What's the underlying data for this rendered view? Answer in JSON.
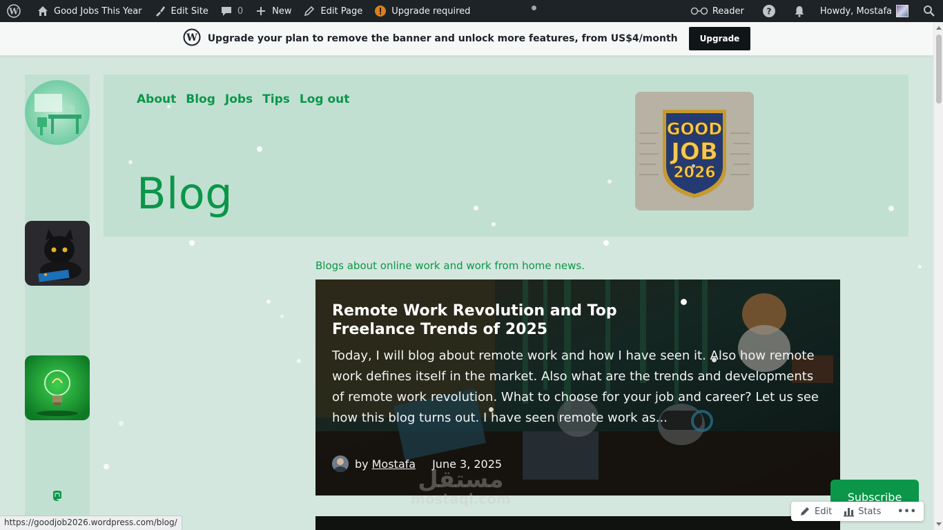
{
  "admin_bar": {
    "site_name": "Good Jobs This Year",
    "edit_site": "Edit Site",
    "comments_count": "0",
    "new_label": "New",
    "edit_page": "Edit Page",
    "upgrade_required": "Upgrade required",
    "reader": "Reader",
    "greeting": "Howdy, Mostafa",
    "icons": [
      "wordpress-logo",
      "home",
      "brush",
      "comment",
      "plus",
      "pencil",
      "alert",
      "reader-glasses",
      "help",
      "bell",
      "search"
    ]
  },
  "banner": {
    "message": "Upgrade your plan to remove the banner and unlock more features, from US$4/month",
    "button": "Upgrade"
  },
  "nav": {
    "items": [
      "About",
      "Blog",
      "Jobs",
      "Tips",
      "Log out"
    ]
  },
  "page": {
    "title": "Blog",
    "tagline": "Blogs about online work and work from home news."
  },
  "logo": {
    "line1": "GOOD",
    "line2": "JOB",
    "line3": "2026"
  },
  "post": {
    "title": "Remote Work Revolution and Top Freelance Trends of 2025",
    "excerpt": "Today, I will blog about remote work and how I have seen it. Also how remote work defines itself in the market. Also what are the trends and developments of remote work revolution. What to choose for your job and career? Let us see how this blog turns out. I have seen remote work as...",
    "by": "by",
    "author": "Mostafa",
    "date": "June 3, 2025"
  },
  "subscribe": "Subscribe",
  "actions": {
    "edit": "Edit",
    "stats": "Stats",
    "more": "•••"
  },
  "status_url": "https://goodjob2026.wordpress.com/blog/",
  "watermark": {
    "arabic": "مستقل",
    "latin": "mostaql.com"
  },
  "colors": {
    "brand_green": "#0b9649",
    "background": "#d4e7de",
    "panel": "#c1e0d2",
    "admin_bar": "#1d2327"
  }
}
